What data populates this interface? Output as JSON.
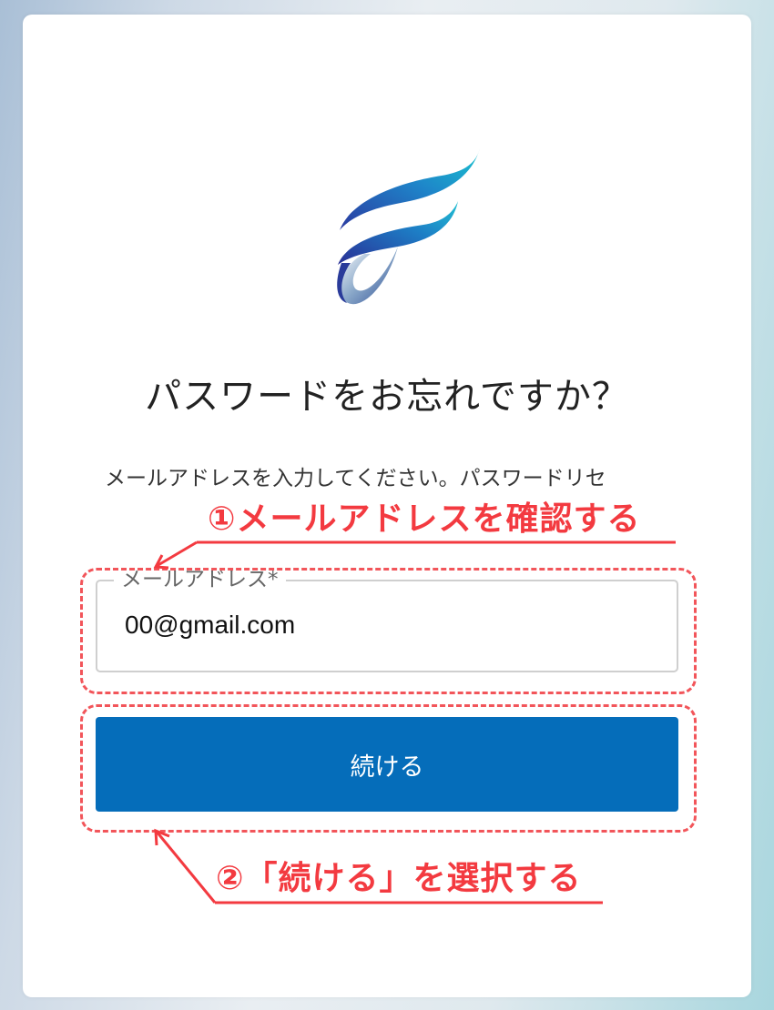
{
  "colors": {
    "primary_button": "#056dba",
    "annotation": "#f33a40",
    "highlight_border": "#f2555a",
    "title_text": "#222222"
  },
  "logo": {
    "icon": "stylized-f-ribbon-logo"
  },
  "page": {
    "title": "パスワードをお忘れですか？",
    "description": "メールアドレスを入力してください。パスワードリセ"
  },
  "email_field": {
    "label": "メールアドレス*",
    "value": "00@gmail.com"
  },
  "continue_button": {
    "label": "続ける"
  },
  "annotations": {
    "step1": "①メールアドレスを確認する",
    "step2": "②「続ける」を選択する"
  }
}
